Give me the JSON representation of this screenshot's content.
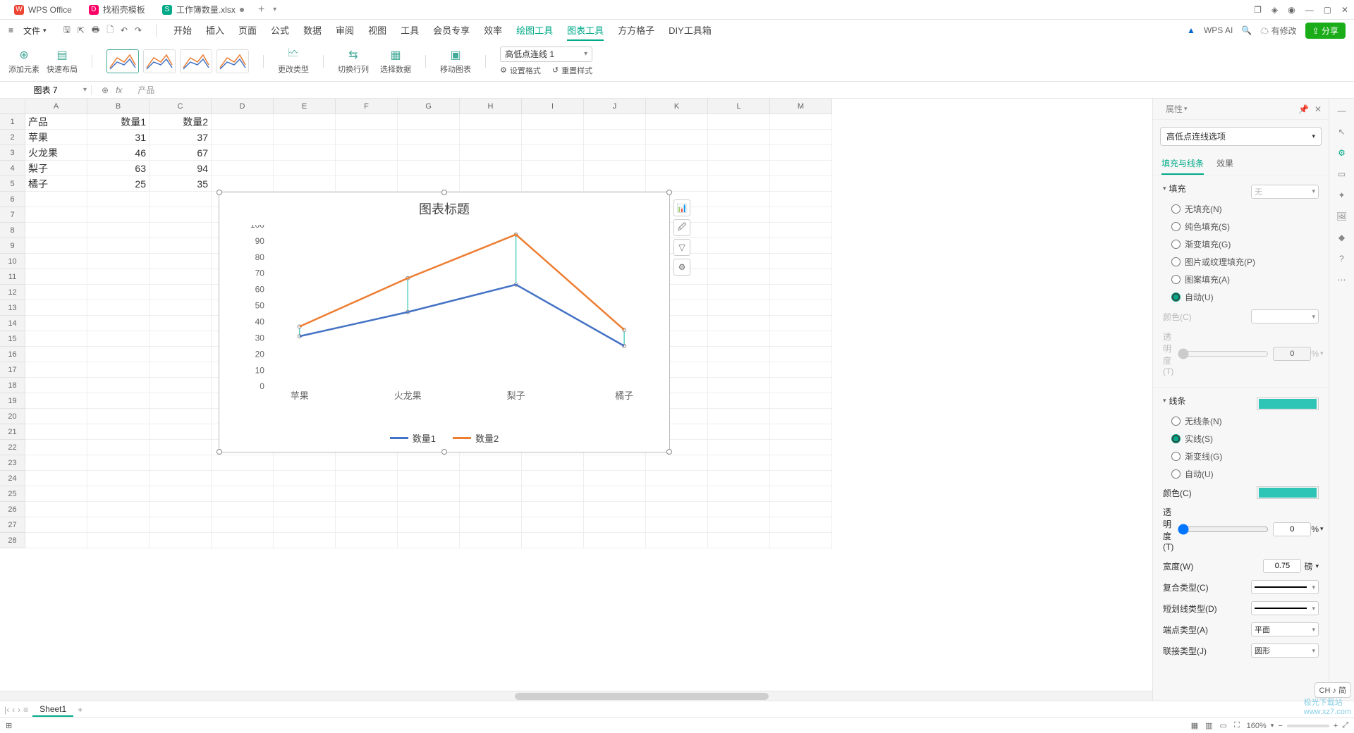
{
  "titlebar": {
    "tabs": [
      {
        "label": "WPS Office"
      },
      {
        "label": "找稻壳模板"
      },
      {
        "label": "工作簿数量.xlsx"
      }
    ],
    "add": "+"
  },
  "menubar": {
    "file": "文件",
    "tabs": [
      "开始",
      "插入",
      "页面",
      "公式",
      "数据",
      "审阅",
      "视图",
      "工具",
      "会员专享",
      "效率",
      "绘图工具",
      "图表工具",
      "方方格子",
      "DIY工具箱"
    ],
    "ai": "WPS AI",
    "save_label": "有修改",
    "share": "分享"
  },
  "ribbon": {
    "add_element": "添加元素",
    "quick_layout": "快速布局",
    "change_type": "更改类型",
    "switch_rowcol": "切换行列",
    "select_data": "选择数据",
    "move_chart": "移动图表",
    "set_format": "设置格式",
    "reset_style": "重置样式",
    "series_select": "高低点连线 1"
  },
  "namebox": "图表 7",
  "formula": "产品",
  "columns": [
    "A",
    "B",
    "C",
    "D",
    "E",
    "F",
    "G",
    "H",
    "I",
    "J",
    "K",
    "L",
    "M"
  ],
  "rows_count": 28,
  "cells": {
    "A1": "产品",
    "B1": "数量1",
    "C1": "数量2",
    "A2": "苹果",
    "B2": "31",
    "C2": "37",
    "A3": "火龙果",
    "B3": "46",
    "C3": "67",
    "A4": "梨子",
    "B4": "63",
    "C4": "94",
    "A5": "橘子",
    "B5": "25",
    "C5": "35"
  },
  "chart_data": {
    "type": "line",
    "title": "图表标题",
    "categories": [
      "苹果",
      "火龙果",
      "梨子",
      "橘子"
    ],
    "series": [
      {
        "name": "数量1",
        "values": [
          31,
          46,
          63,
          25
        ],
        "color": "#4472C4"
      },
      {
        "name": "数量2",
        "values": [
          37,
          67,
          94,
          35
        ],
        "color": "#ED7D31"
      }
    ],
    "ylim": [
      0,
      100
    ],
    "ytick": 10,
    "high_low_lines": true,
    "high_low_line_color": "#2ec4b6",
    "legend_position": "bottom"
  },
  "prop": {
    "title": "属性",
    "selector": "高低点连线选项",
    "tabs": [
      "填充与线条",
      "效果"
    ],
    "fill": {
      "title": "填充",
      "select_none": "无",
      "options": [
        "无填充(N)",
        "纯色填充(S)",
        "渐变填充(G)",
        "图片或纹理填充(P)",
        "图案填充(A)",
        "自动(U)"
      ],
      "color_label": "颜色(C)",
      "trans_label": "透明度(T)",
      "trans_val": "0",
      "trans_unit": "%"
    },
    "line": {
      "title": "线条",
      "options": [
        "无线条(N)",
        "实线(S)",
        "渐变线(G)",
        "自动(U)"
      ],
      "selected": 1,
      "color_label": "颜色(C)",
      "color": "#2ec4b6",
      "trans_label": "透明度(T)",
      "trans_val": "0",
      "trans_unit": "%",
      "width_label": "宽度(W)",
      "width_val": "0.75",
      "width_unit": "磅",
      "compound_label": "复合类型(C)",
      "dash_label": "短划线类型(D)",
      "cap_label": "端点类型(A)",
      "cap_val": "平面",
      "join_label": "联接类型(J)",
      "join_val": "圆形"
    }
  },
  "sheet_tabs": {
    "name": "Sheet1"
  },
  "statusbar": {
    "zoom": "160%"
  },
  "ime": "CH ♪ 简",
  "watermark": {
    "l1": "极光下载站",
    "l2": "www.xz7.com"
  }
}
